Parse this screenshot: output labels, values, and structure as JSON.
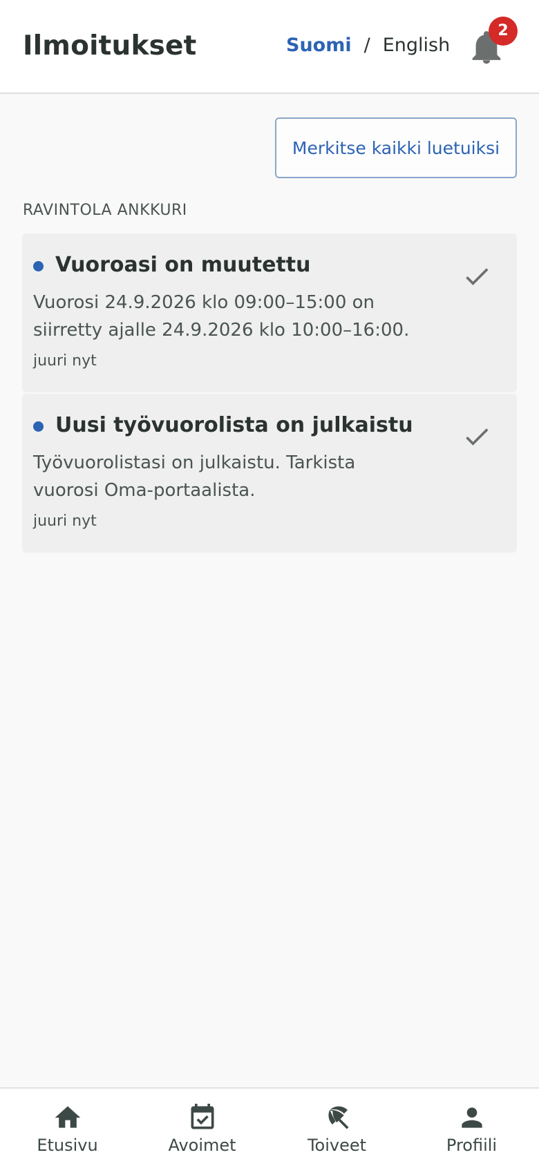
{
  "header": {
    "title": "Ilmoitukset",
    "lang_fi": "Suomi",
    "lang_separator": "/",
    "lang_en": "English",
    "notification_count": "2",
    "bell_icon": "bell-icon"
  },
  "actions": {
    "mark_all_label": "Merkitse kaikki luetuiksi"
  },
  "section": {
    "heading": "RAVINTOLA ANKKURI"
  },
  "notifications": [
    {
      "title": "Vuoroasi on muutettu",
      "body": "Vuorosi 24.9.2026 klo 09:00–15:00 on siirretty ajalle 24.9.2026 klo 10:00–16:00.",
      "time": "juuri nyt",
      "unread": true
    },
    {
      "title": "Uusi työvuorolista on julkaistu",
      "body": "Työvuorolistasi on julkaistu. Tarkista vuorosi Oma-portaalista.",
      "time": "juuri nyt",
      "unread": true
    }
  ],
  "bottom_nav": [
    {
      "label": "Etusivu",
      "icon": "home-icon"
    },
    {
      "label": "Avoimet",
      "icon": "calendar-check-icon"
    },
    {
      "label": "Toiveet",
      "icon": "beach-umbrella-icon"
    },
    {
      "label": "Profiili",
      "icon": "person-icon"
    }
  ],
  "colors": {
    "accent": "#2c63b3",
    "badge": "#d42a28",
    "card_bg": "#efefef",
    "page_bg": "#f9f9f9"
  }
}
